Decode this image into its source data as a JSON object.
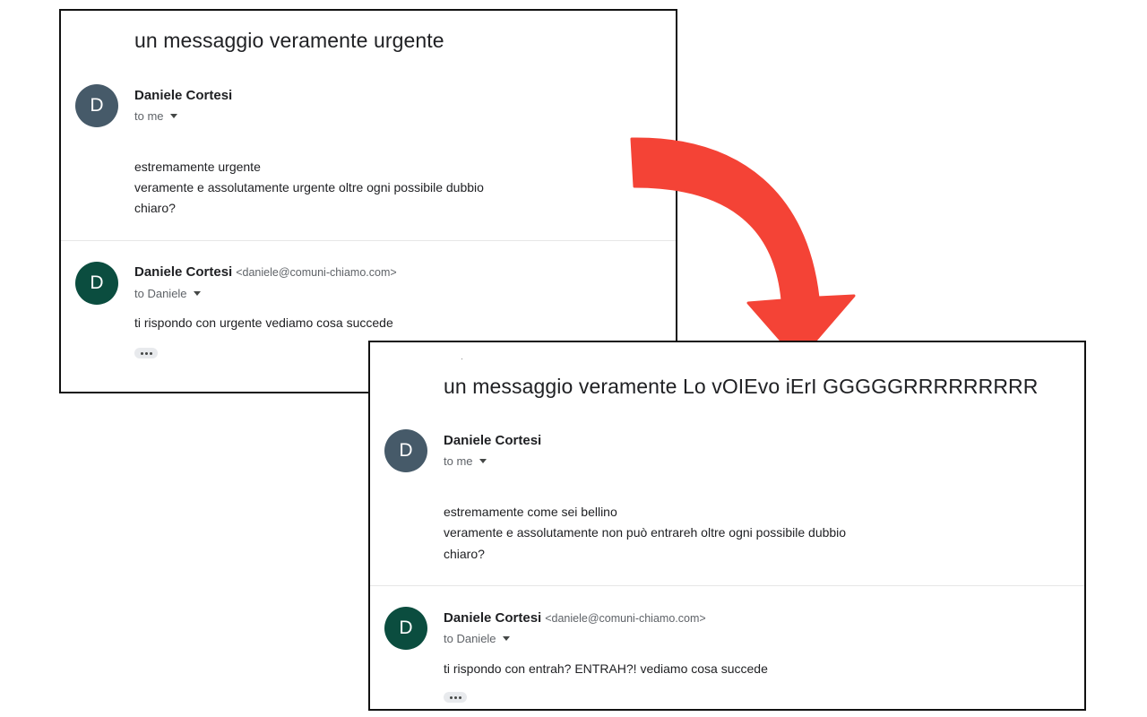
{
  "colors": {
    "arrow": "#f44336",
    "avatar_first": "#465a69",
    "avatar_reply": "#0b4d3f",
    "frame": "#111111"
  },
  "before": {
    "subject": "un messaggio veramente urgente",
    "message1": {
      "avatar_letter": "D",
      "sender": "Daniele Cortesi",
      "recipient": "to me",
      "body": [
        "estremamente urgente",
        "veramente e assolutamente urgente oltre ogni possibile dubbio",
        "chiaro?"
      ]
    },
    "message2": {
      "avatar_letter": "D",
      "sender": "Daniele Cortesi",
      "email": "<daniele@comuni-chiamo.com>",
      "recipient": "to Daniele",
      "body": "ti rispondo con urgente vediamo cosa succede"
    }
  },
  "after": {
    "subject": "un messaggio veramente Lo vOIEvo iErI GGGGGRRRRRRRRR",
    "message1": {
      "avatar_letter": "D",
      "sender": "Daniele Cortesi",
      "recipient": "to me",
      "body": [
        "estremamente come sei bellino",
        "veramente e assolutamente non può entrareh oltre ogni possibile dubbio",
        "chiaro?"
      ]
    },
    "message2": {
      "avatar_letter": "D",
      "sender": "Daniele Cortesi",
      "email": "<daniele@comuni-chiamo.com>",
      "recipient": "to Daniele",
      "body": "ti rispondo con entrah? ENTRAH?! vediamo cosa succede"
    }
  },
  "icons": {
    "arrow": "curved-arrow-icon",
    "caret": "caret-down-icon",
    "more": "more-horiz-icon"
  }
}
